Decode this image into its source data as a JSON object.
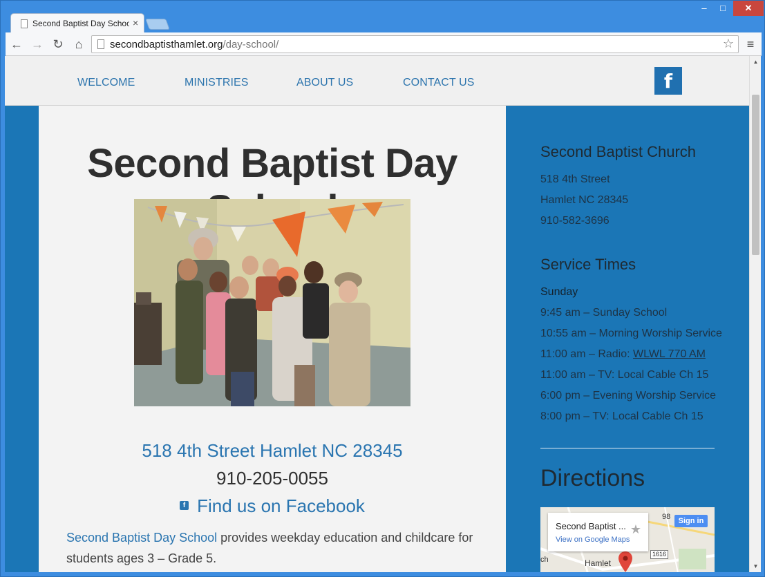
{
  "browser": {
    "tab_title": "Second Baptist Day Schoo",
    "tab_close": "×",
    "url_domain": "secondbaptisthamlet.org",
    "url_path": "/day-school/",
    "win_minimize": "–",
    "win_maximize": "□",
    "win_close": "✕",
    "back": "←",
    "forward": "→",
    "reload": "↻",
    "home": "⌂",
    "star": "☆",
    "menu": "≡"
  },
  "nav": {
    "items": [
      "WELCOME",
      "MINISTRIES",
      "ABOUT US",
      "CONTACT US"
    ],
    "facebook_glyph": "f"
  },
  "main": {
    "title": "Second Baptist Day School",
    "address": "518 4th Street  Hamlet NC 28345",
    "phone": "910-205-0055",
    "facebook_link": "Find us on Facebook",
    "facebook_icon_glyph": "f",
    "intro_link": "Second Baptist Day School",
    "intro_text": " provides weekday education and childcare for students ages 3 – Grade 5."
  },
  "sidebar": {
    "church_heading": "Second Baptist Church",
    "church_lines": [
      "518 4th Street",
      "Hamlet NC 28345",
      "910-582-3696"
    ],
    "service_heading": "Service Times",
    "service_day": "Sunday",
    "services": [
      "9:45 am – Sunday School",
      "10:55 am – Morning Worship Service",
      "11:00 am – Radio: ",
      "11:00 am – TV: Local Cable Ch 15",
      "6:00 pm – Evening Worship Service",
      "8:00 pm – TV: Local Cable Ch 15"
    ],
    "radio_link": "WLWL 770 AM",
    "directions_heading": "Directions"
  },
  "map": {
    "card_title": "Second Baptist ...",
    "card_link": "View on Google Maps",
    "star": "★",
    "signin": "Sign in",
    "shield": "1616",
    "place": "Hamlet",
    "label_ch": "ch",
    "label_98": "98"
  },
  "colors": {
    "accent_blue": "#1b76b6",
    "link_blue": "#2a75b0",
    "content_bg": "#f3f3f3"
  }
}
